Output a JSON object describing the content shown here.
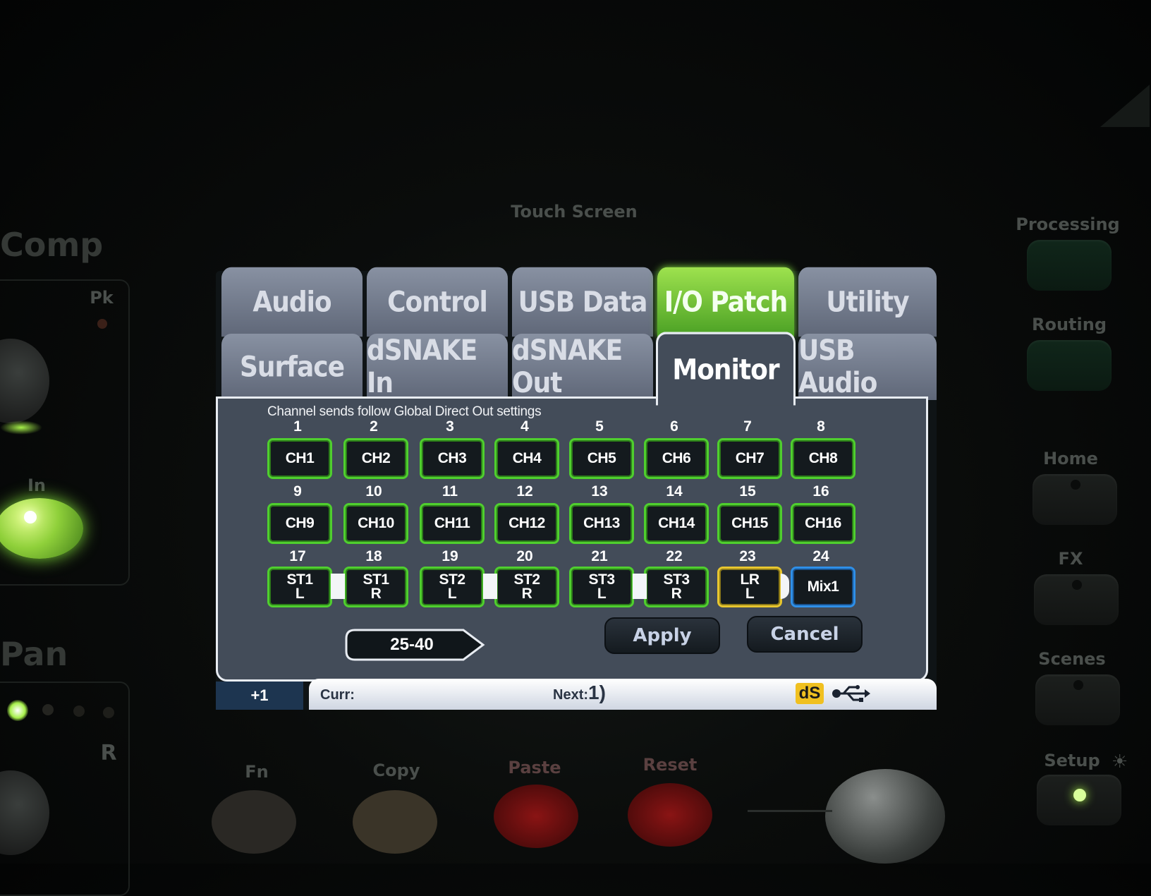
{
  "hardware": {
    "touch_screen_label": "Touch Screen",
    "comp_label": "Comp",
    "pk_label": "Pk",
    "in_label": "In",
    "pan_label": "Pan",
    "r_label": "R",
    "right_buttons": [
      "Processing",
      "Routing",
      "Home",
      "FX",
      "Scenes",
      "Setup"
    ],
    "bottom_buttons": [
      "Fn",
      "Copy",
      "Paste",
      "Reset"
    ]
  },
  "tabs_top": [
    {
      "label": "Audio"
    },
    {
      "label": "Control"
    },
    {
      "label": "USB Data"
    },
    {
      "label": "I/O Patch"
    },
    {
      "label": "Utility"
    }
  ],
  "tabs_sub": [
    {
      "label": "Surface"
    },
    {
      "label": "dSNAKE In"
    },
    {
      "label": "dSNAKE Out"
    },
    {
      "label": "Monitor"
    },
    {
      "label": "USB Audio"
    }
  ],
  "active": {
    "top_tab": "I/O Patch",
    "sub_tab": "Monitor"
  },
  "notice": "Channel sends follow Global Direct Out settings",
  "channels": [
    {
      "num": "1",
      "line1": "CH1",
      "line2": ""
    },
    {
      "num": "2",
      "line1": "CH2",
      "line2": ""
    },
    {
      "num": "3",
      "line1": "CH3",
      "line2": ""
    },
    {
      "num": "4",
      "line1": "CH4",
      "line2": ""
    },
    {
      "num": "5",
      "line1": "CH5",
      "line2": ""
    },
    {
      "num": "6",
      "line1": "CH6",
      "line2": ""
    },
    {
      "num": "7",
      "line1": "CH7",
      "line2": ""
    },
    {
      "num": "8",
      "line1": "CH8",
      "line2": ""
    },
    {
      "num": "9",
      "line1": "CH9",
      "line2": ""
    },
    {
      "num": "10",
      "line1": "CH10",
      "line2": ""
    },
    {
      "num": "11",
      "line1": "CH11",
      "line2": ""
    },
    {
      "num": "12",
      "line1": "CH12",
      "line2": ""
    },
    {
      "num": "13",
      "line1": "CH13",
      "line2": ""
    },
    {
      "num": "14",
      "line1": "CH14",
      "line2": ""
    },
    {
      "num": "15",
      "line1": "CH15",
      "line2": ""
    },
    {
      "num": "16",
      "line1": "CH16",
      "line2": ""
    },
    {
      "num": "17",
      "line1": "ST1",
      "line2": "L"
    },
    {
      "num": "18",
      "line1": "ST1",
      "line2": "R"
    },
    {
      "num": "19",
      "line1": "ST2",
      "line2": "L"
    },
    {
      "num": "20",
      "line1": "ST2",
      "line2": "R"
    },
    {
      "num": "21",
      "line1": "ST3",
      "line2": "L"
    },
    {
      "num": "22",
      "line1": "ST3",
      "line2": "R"
    },
    {
      "num": "23",
      "line1": "LR",
      "line2": "L"
    },
    {
      "num": "24",
      "line1": "Mix1",
      "line2": ""
    }
  ],
  "buttons": {
    "range": "25-40",
    "apply": "Apply",
    "cancel": "Cancel"
  },
  "status": {
    "plus_one": "+1",
    "curr_label": "Curr:",
    "next_label": "Next:",
    "next_value": "1)",
    "ds_badge": "dS"
  },
  "colors": {
    "green_accent": "#4fcf2e",
    "lr_yellow": "#e8c62e",
    "mix_blue": "#2e8fe8",
    "tab_grey": "#6f7889",
    "content_bg": "#434c59"
  }
}
